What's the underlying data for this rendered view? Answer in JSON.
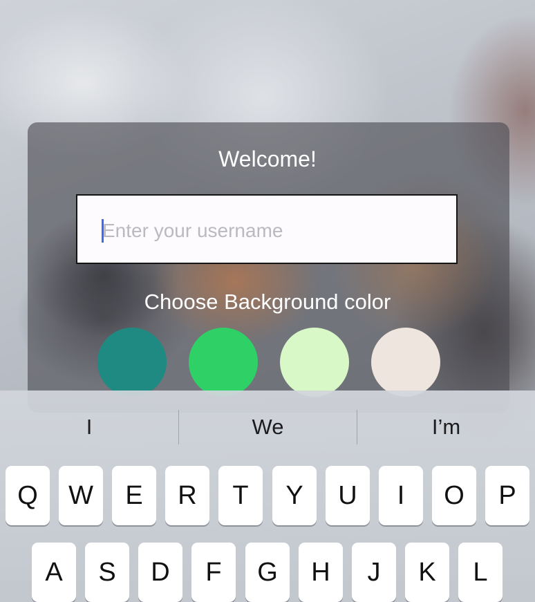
{
  "background": {
    "photo": "blurred photo of two smiling people"
  },
  "dialog": {
    "title": "Welcome!",
    "username_placeholder": "Enter your username",
    "username_value": "",
    "color_prompt": "Choose Background color",
    "color_options": [
      {
        "color": "#1f8a82"
      },
      {
        "color": "#2fd066"
      },
      {
        "color": "#d9f8c8"
      },
      {
        "color": "#efe5df"
      }
    ]
  },
  "keyboard": {
    "suggestions": [
      "I",
      "We",
      "I’m"
    ],
    "row1": [
      "Q",
      "W",
      "E",
      "R",
      "T",
      "Y",
      "U",
      "I",
      "O",
      "P"
    ],
    "row2": [
      "A",
      "S",
      "D",
      "F",
      "G",
      "H",
      "J",
      "K",
      "L"
    ]
  }
}
